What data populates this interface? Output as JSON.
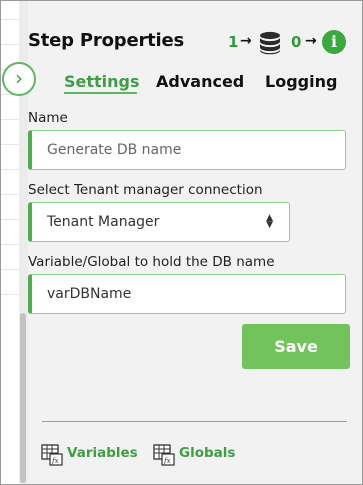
{
  "header": {
    "title": "Step Properties",
    "in_count": "1",
    "out_count": "0",
    "arrow": "→",
    "db_icon": "database-icon",
    "info_icon": "info-icon",
    "info_glyph": "i"
  },
  "collapse": {
    "glyph": "›",
    "icon": "chevron-right-icon"
  },
  "tabs": [
    {
      "label": "Settings",
      "active": true
    },
    {
      "label": "Advanced",
      "active": false
    },
    {
      "label": "Logging",
      "active": false
    }
  ],
  "form": {
    "name": {
      "label": "Name",
      "value": "Generate DB name"
    },
    "connection": {
      "label": "Select Tenant manager connection",
      "value": "Tenant Manager"
    },
    "variable": {
      "label": "Variable/Global to hold the DB name",
      "value": "varDBName"
    }
  },
  "buttons": {
    "save": "Save"
  },
  "footer": {
    "variables": {
      "label": "Variables",
      "icon": "variables-fx-icon"
    },
    "globals": {
      "label": "Globals",
      "icon": "globals-fx-icon"
    }
  },
  "colors": {
    "accent": "#5cb85c",
    "accent_text": "#3f9e45",
    "save_bg": "#72c35b",
    "panel_bg": "#f2f2f2"
  }
}
